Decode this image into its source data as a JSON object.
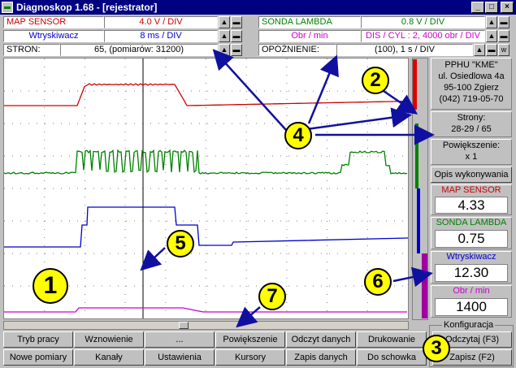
{
  "window": {
    "title": "Diagnoskop 1.68 - [rejestrator]",
    "minimize": "_",
    "maximize": "□",
    "close": "×"
  },
  "channels": {
    "ch1": {
      "name": "MAP SENSOR",
      "scale": "4.0 V / DIV",
      "color": "#cc0000"
    },
    "ch2": {
      "name": "Wtryskiwacz",
      "scale": "8 ms / DIV",
      "color": "#0000cc"
    },
    "ch3": {
      "name": "SONDA LAMBDA",
      "scale": "0.8 V / DIV",
      "color": "#008000"
    },
    "ch4": {
      "name": "Obr / min",
      "scale": "DIS / CYL : 2,  4000 obr / DIV",
      "color": "#cc00cc"
    }
  },
  "strony_row": {
    "label": "STRON:",
    "value": "65,  (pomiarów: 31200)"
  },
  "opoznienie_row": {
    "label": "OPÓŹNIENIE:",
    "value": "(100),  1 s / DIV",
    "w_button": "w"
  },
  "spin": {
    "up": "▲",
    "down": "▬"
  },
  "company": [
    "PPHU \"KME\"",
    "ul. Osiedlowa 4a",
    "95-100 Zgierz",
    "(042) 719-05-70"
  ],
  "pages": {
    "label": "Strony:",
    "value": "28-29 / 65"
  },
  "zoom": {
    "label": "Powiększenie:",
    "value": "x 1"
  },
  "description_button": "Opis wykonywania",
  "readouts": [
    {
      "name": "MAP SENSOR",
      "value": "4.33",
      "color": "#cc0000"
    },
    {
      "name": "SONDA LAMBDA",
      "value": "0.75",
      "color": "#008000"
    },
    {
      "name": "Wtryskiwacz",
      "value": "12.30",
      "color": "#0000cc"
    },
    {
      "name": "Obr / min",
      "value": "1400",
      "color": "#cc00cc"
    }
  ],
  "buttons_row1": [
    "Tryb pracy",
    "Wznowienie",
    "...",
    "Powiększenie",
    "Odczyt danych",
    "Drukowanie"
  ],
  "buttons_row2": [
    "Nowe pomiary",
    "Kanały",
    "Ustawienia",
    "Kursory",
    "Zapis danych",
    "Do schowka"
  ],
  "config": {
    "label": "Konfiguracja",
    "read": "Odczytaj (F3)",
    "save": "Zapisz (F2)"
  },
  "badges": [
    "1",
    "2",
    "3",
    "4",
    "5",
    "6",
    "7"
  ]
}
